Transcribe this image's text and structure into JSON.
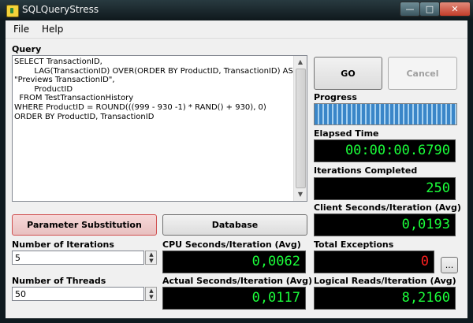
{
  "window": {
    "title": "SQLQueryStress"
  },
  "menu": {
    "file": "File",
    "help": "Help"
  },
  "query": {
    "label": "Query",
    "text": "SELECT TransactionID,\n        LAG(TransactionID) OVER(ORDER BY ProductID, TransactionID) AS\n\"Previews TransactionID\",\n        ProductID\n  FROM TestTransactionHistory\nWHERE ProductID = ROUND(((999 - 930 -1) * RAND() + 930), 0)\nORDER BY ProductID, TransactionID"
  },
  "buttons": {
    "go": "GO",
    "cancel": "Cancel",
    "parameter_substitution": "Parameter Substitution",
    "database": "Database",
    "ellipsis": "..."
  },
  "progress": {
    "label": "Progress",
    "fraction": 1.0
  },
  "stats": {
    "elapsed_time": {
      "label": "Elapsed Time",
      "value": "00:00:00.6790"
    },
    "iterations_completed": {
      "label": "Iterations Completed",
      "value": "250"
    },
    "client_seconds": {
      "label": "Client Seconds/Iteration (Avg)",
      "value": "0,0193"
    },
    "cpu_seconds": {
      "label": "CPU Seconds/Iteration (Avg)",
      "value": "0,0062"
    },
    "total_exceptions": {
      "label": "Total Exceptions",
      "value": "0"
    },
    "actual_seconds": {
      "label": "Actual Seconds/Iteration (Avg)",
      "value": "0,0117"
    },
    "logical_reads": {
      "label": "Logical Reads/Iteration (Avg)",
      "value": "8,2160"
    }
  },
  "settings": {
    "iterations": {
      "label": "Number of Iterations",
      "value": "5"
    },
    "threads": {
      "label": "Number of Threads",
      "value": "50"
    }
  },
  "colors": {
    "lcd_text": "#1bff3a",
    "lcd_error_text": "#ff2020",
    "progress_fill": "#3a86c8"
  }
}
